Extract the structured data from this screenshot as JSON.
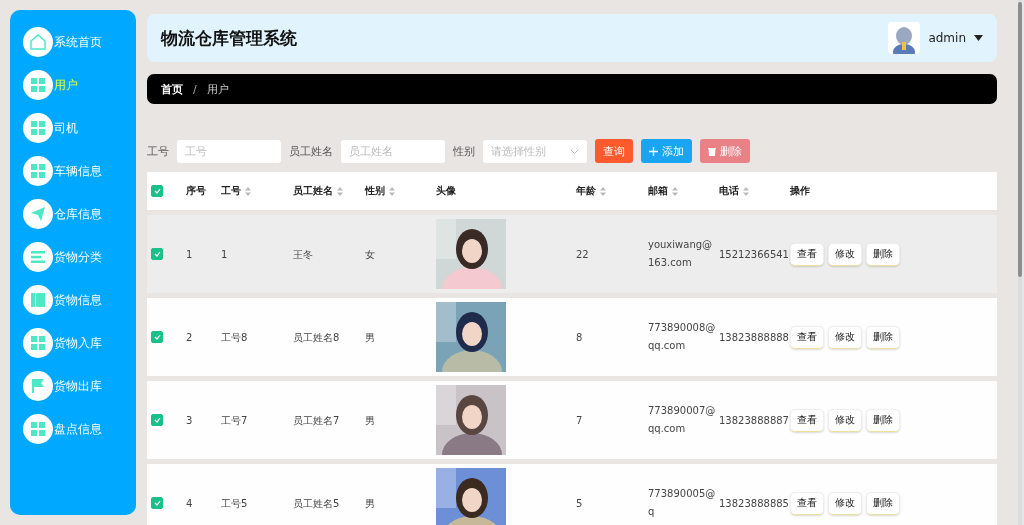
{
  "sidebar": {
    "items": [
      {
        "label": "系统首页",
        "kind": "home",
        "selected": false
      },
      {
        "label": "用户",
        "kind": "grid",
        "selected": true
      },
      {
        "label": "司机",
        "kind": "grid",
        "selected": false
      },
      {
        "label": "车辆信息",
        "kind": "grid",
        "selected": false
      },
      {
        "label": "仓库信息",
        "kind": "plane",
        "selected": false
      },
      {
        "label": "货物分类",
        "kind": "list",
        "selected": false
      },
      {
        "label": "货物信息",
        "kind": "book",
        "selected": false
      },
      {
        "label": "货物入库",
        "kind": "grid",
        "selected": false
      },
      {
        "label": "货物出库",
        "kind": "flag",
        "selected": false
      },
      {
        "label": "盘点信息",
        "kind": "grid",
        "selected": false
      }
    ]
  },
  "header": {
    "title": "物流仓库管理系统",
    "user": "admin"
  },
  "breadcrumb": {
    "items": [
      "首页",
      "用户"
    ],
    "separator": "/"
  },
  "filters": [
    {
      "label": "工号",
      "placeholder": "工号",
      "kind": "input"
    },
    {
      "label": "员工姓名",
      "placeholder": "员工姓名",
      "kind": "input"
    },
    {
      "label": "性别",
      "placeholder": "请选择性别",
      "kind": "select"
    }
  ],
  "actions": [
    {
      "label": "查询",
      "kind": "search"
    },
    {
      "label": "添加",
      "kind": "add"
    },
    {
      "label": "删除",
      "kind": "delete"
    }
  ],
  "table": {
    "all_checked": true,
    "columns": [
      {
        "label": "序号",
        "sortable": false
      },
      {
        "label": "工号",
        "sortable": true
      },
      {
        "label": "员工姓名",
        "sortable": true
      },
      {
        "label": "性别",
        "sortable": true
      },
      {
        "label": "头像",
        "sortable": false
      },
      {
        "label": "年龄",
        "sortable": true
      },
      {
        "label": "邮箱",
        "sortable": true
      },
      {
        "label": "电话",
        "sortable": true
      },
      {
        "label": "操作",
        "sortable": false
      }
    ],
    "rows": [
      {
        "checked": true,
        "highlighted": true,
        "cells": [
          "1",
          "1",
          "王冬",
          "女",
          {
            "kind": "picture"
          },
          "22",
          "youxiwang@163.com",
          "15212366541"
        ],
        "actions": [
          "查看",
          "修改",
          "删除"
        ]
      },
      {
        "checked": true,
        "highlighted": false,
        "cells": [
          "2",
          "工号8",
          "员工姓名8",
          "男",
          {
            "kind": "picture"
          },
          "8",
          "773890008@qq.com",
          "13823888888"
        ],
        "actions": [
          "查看",
          "修改",
          "删除"
        ]
      },
      {
        "checked": true,
        "highlighted": false,
        "cells": [
          "3",
          "工号7",
          "员工姓名7",
          "男",
          {
            "kind": "picture"
          },
          "7",
          "773890007@qq.com",
          "13823888887"
        ],
        "actions": [
          "查看",
          "修改",
          "删除"
        ]
      },
      {
        "checked": true,
        "highlighted": false,
        "cells": [
          "4",
          "工号5",
          "员工姓名5",
          "男",
          {
            "kind": "picture"
          },
          "5",
          "773890005@q",
          "13823888885"
        ],
        "actions": [
          "查看",
          "修改",
          "删除"
        ]
      }
    ]
  }
}
